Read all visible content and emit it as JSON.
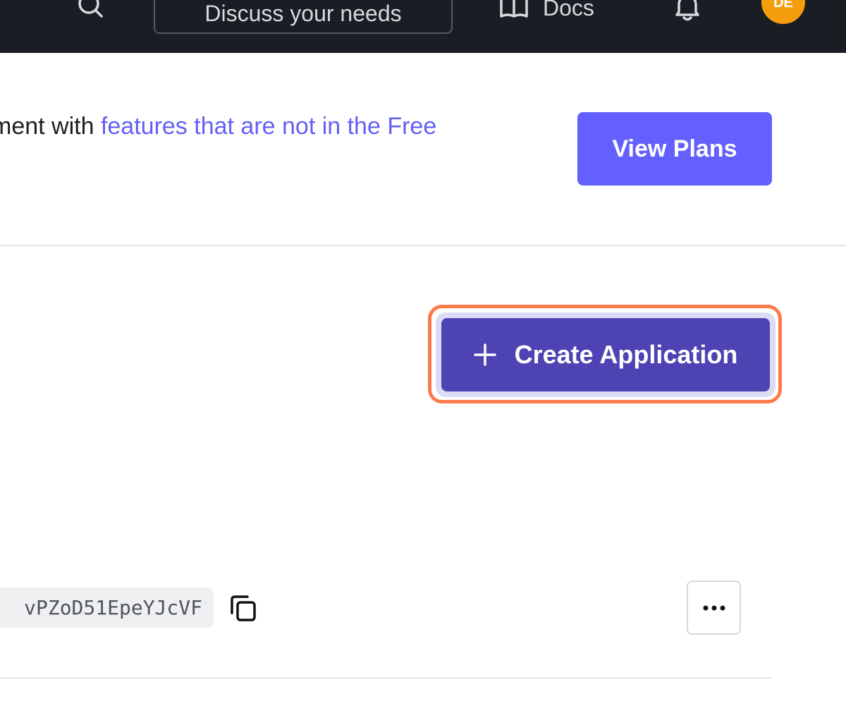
{
  "header": {
    "search_icon": "search-icon",
    "discuss_label": "Discuss your needs",
    "docs_label": "Docs",
    "docs_icon": "book-icon",
    "bell_icon": "bell-icon",
    "avatar_initials": "DE",
    "avatar_color": "#f59e0b",
    "background": "#1b1d24"
  },
  "banner": {
    "text_before": "ment with ",
    "link_text": "features that are not in the Free",
    "button_label": "View Plans",
    "accent": "#6360ff"
  },
  "applications": {
    "create_label": "Create Application",
    "create_icon": "plus-icon",
    "create_color": "#4e43b3",
    "highlight_color": "#ff7a4a"
  },
  "app_row": {
    "client_id_visible": "vPZoD51EpeYJcVF",
    "copy_icon": "copy-icon",
    "more_icon": "ellipsis-icon"
  }
}
